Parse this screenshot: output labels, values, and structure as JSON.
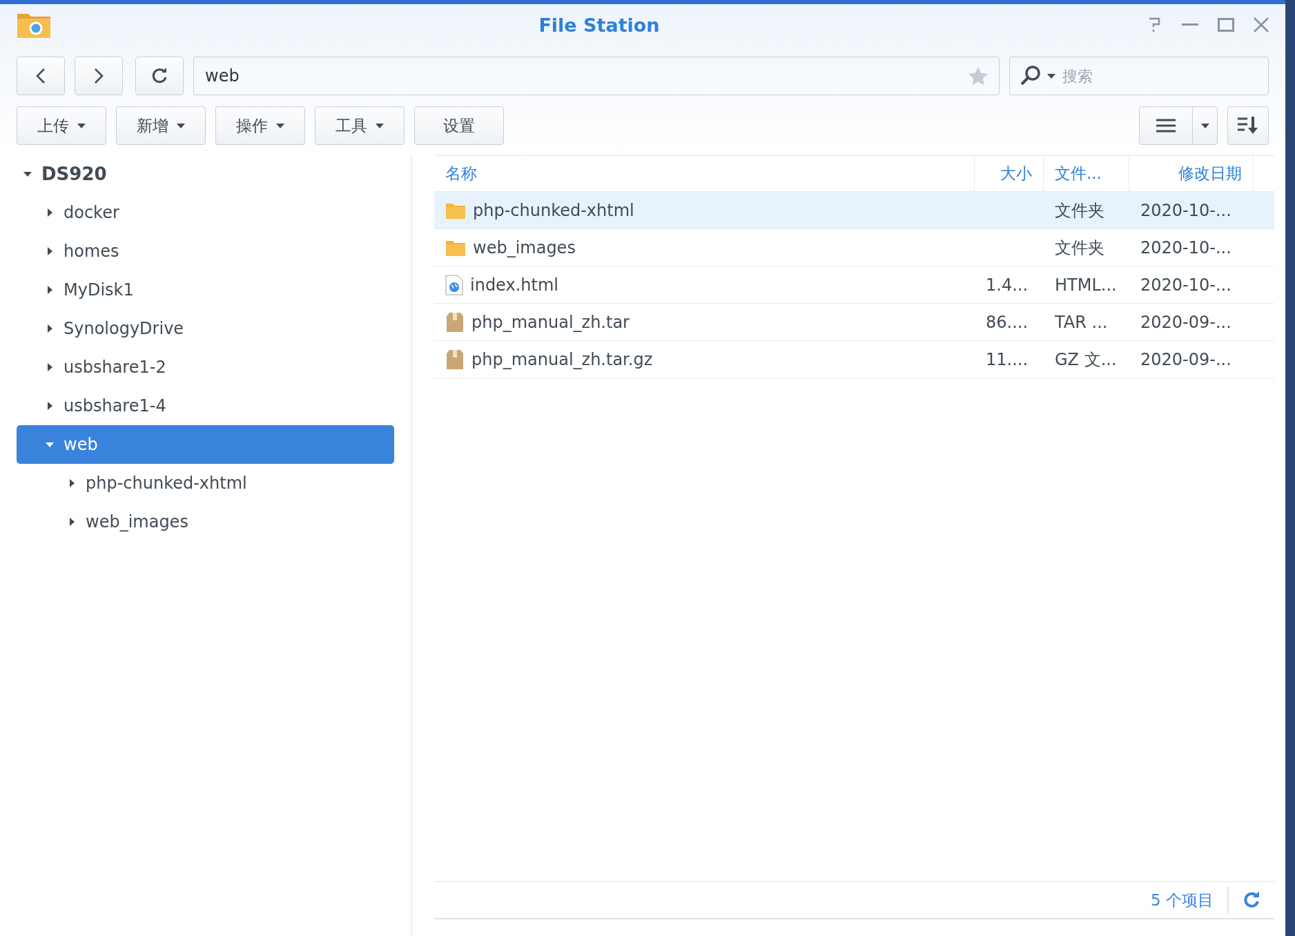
{
  "window": {
    "title": "File Station"
  },
  "nav": {
    "path": "web",
    "search_placeholder": "搜索"
  },
  "toolbar": [
    {
      "label": "上传",
      "dropdown": true
    },
    {
      "label": "新增",
      "dropdown": true
    },
    {
      "label": "操作",
      "dropdown": true
    },
    {
      "label": "工具",
      "dropdown": true
    },
    {
      "label": "设置",
      "dropdown": false
    }
  ],
  "tree": {
    "label": "DS920",
    "expanded": true,
    "selected": false,
    "children": [
      {
        "label": "docker",
        "expanded": false,
        "selected": false
      },
      {
        "label": "homes",
        "expanded": false,
        "selected": false
      },
      {
        "label": "MyDisk1",
        "expanded": false,
        "selected": false
      },
      {
        "label": "SynologyDrive",
        "expanded": false,
        "selected": false
      },
      {
        "label": "usbshare1-2",
        "expanded": false,
        "selected": false
      },
      {
        "label": "usbshare1-4",
        "expanded": false,
        "selected": false
      },
      {
        "label": "web",
        "expanded": true,
        "selected": true,
        "children": [
          {
            "label": "php-chunked-xhtml",
            "expanded": false,
            "selected": false
          },
          {
            "label": "web_images",
            "expanded": false,
            "selected": false
          }
        ]
      }
    ]
  },
  "table": {
    "columns": [
      "名称",
      "大小",
      "文件...",
      "修改日期"
    ],
    "rows": [
      {
        "kind": "folder",
        "name": "php-chunked-xhtml",
        "size": "",
        "type": "文件夹",
        "modified": "2020-10-...",
        "selected": true
      },
      {
        "kind": "folder",
        "name": "web_images",
        "size": "",
        "type": "文件夹",
        "modified": "2020-10-...",
        "selected": false
      },
      {
        "kind": "html",
        "name": "index.html",
        "size": "1.4...",
        "type": "HTML...",
        "modified": "2020-10-...",
        "selected": false
      },
      {
        "kind": "archive",
        "name": "php_manual_zh.tar",
        "size": "86....",
        "type": "TAR ...",
        "modified": "2020-09-...",
        "selected": false
      },
      {
        "kind": "archive",
        "name": "php_manual_zh.tar.gz",
        "size": "11....",
        "type": "GZ 文...",
        "modified": "2020-09-...",
        "selected": false
      }
    ]
  },
  "status_bar": {
    "count": "5 个项目"
  }
}
